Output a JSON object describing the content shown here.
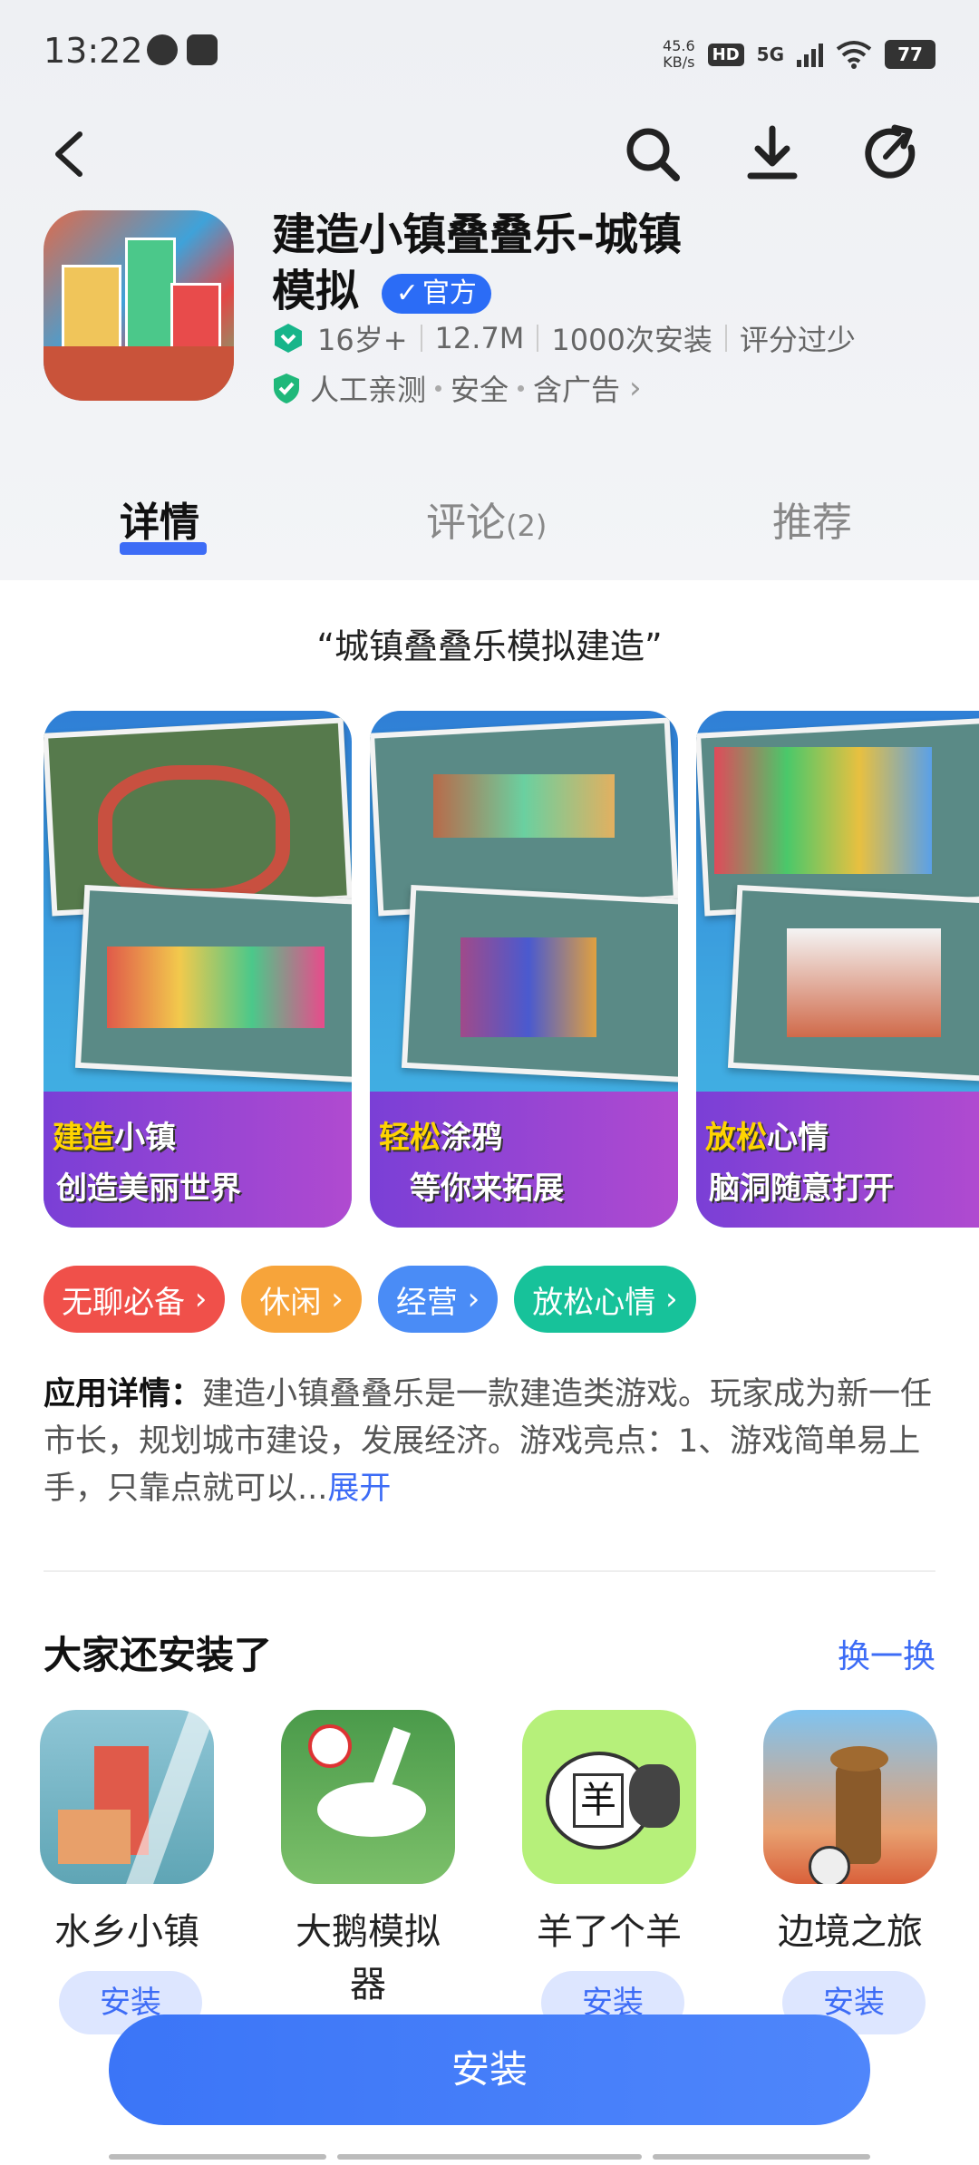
{
  "status_bar": {
    "time": "13:22",
    "speed_value": "45.6",
    "speed_unit": "KB/s",
    "hd": "HD",
    "network": "5G",
    "battery": "77"
  },
  "app": {
    "title_line1": "建造小镇叠叠乐-城镇",
    "title_line2": "模拟",
    "official_badge": "官方",
    "age_rating": "16岁+",
    "size": "12.7M",
    "installs": "1000次安装",
    "rating": "评分过少",
    "verify_1": "人工亲测",
    "verify_2": "安全",
    "verify_3": "含广告"
  },
  "tabs": {
    "details": "详情",
    "reviews": "评论",
    "reviews_count": "(2)",
    "recommend": "推荐"
  },
  "slogan": "“城镇叠叠乐模拟建造”",
  "screenshots": [
    {
      "hl": "建造",
      "rest": "小镇",
      "line2": "创造美丽世界"
    },
    {
      "hl": "轻松",
      "rest": "涂鸦",
      "line2": "等你来拓展"
    },
    {
      "hl": "放松",
      "rest": "心情",
      "line2": "脑洞随意打开"
    }
  ],
  "tags": [
    "无聊必备",
    "休闲",
    "经营",
    "放松心情"
  ],
  "tag_colors": [
    "#f0504a",
    "#f7a43a",
    "#4a8cf6",
    "#17c29a"
  ],
  "description": {
    "label": "应用详情：",
    "text": "建造小镇叠叠乐是一款建造类游戏。玩家成为新一任市长，规划城市建设，发展经济。游戏亮点：1、游戏简单易上手，只靠点就可以...",
    "expand": "展开"
  },
  "also_installed": {
    "title": "大家还安装了",
    "refresh": "换一换",
    "apps": [
      {
        "name": "水乡小镇",
        "button": "安装"
      },
      {
        "name": "大鹅模拟器",
        "button": "安装"
      },
      {
        "name": "羊了个羊",
        "button": "安装"
      },
      {
        "name": "边境之旅",
        "button": "安装"
      }
    ]
  },
  "install_button": "安装",
  "sheep_glyph": "羊",
  "accent_color": "#3d6cf6"
}
